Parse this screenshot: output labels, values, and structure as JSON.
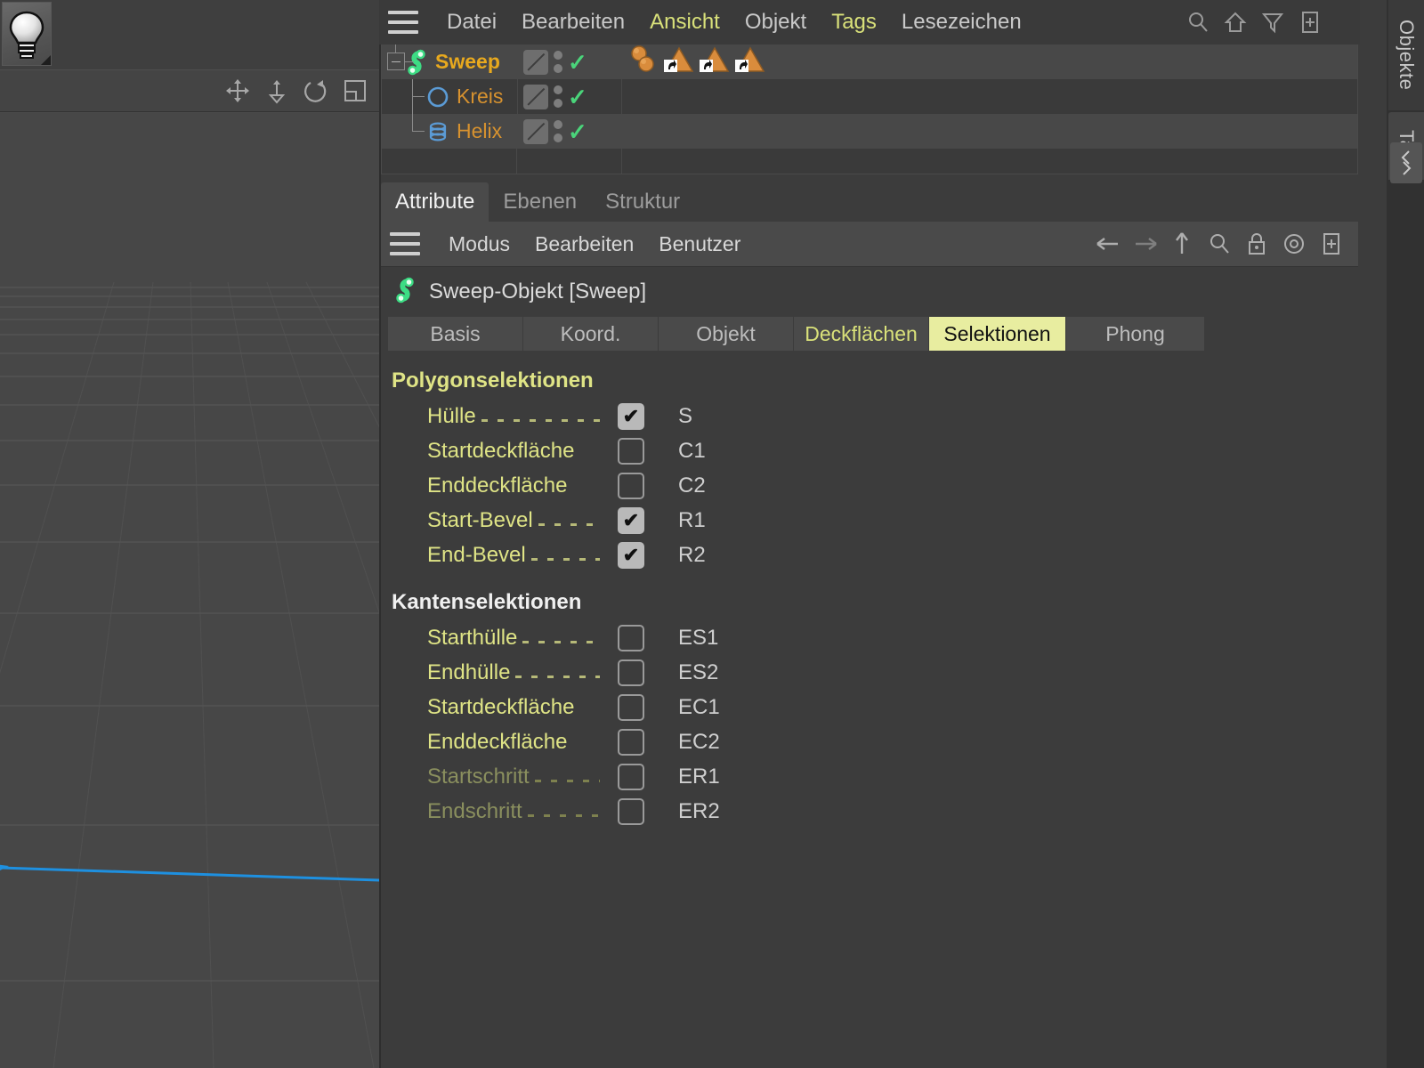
{
  "viewport": {
    "light_icon": "lightbulb-icon",
    "tools": [
      "move-icon",
      "scale-icon",
      "rotate-icon",
      "maximize-icon"
    ],
    "axis_color": "#1e90e0",
    "grid_color": "#5a5a5a",
    "background": "#474747"
  },
  "object_manager": {
    "menu": [
      {
        "label": "Datei",
        "highlight": false
      },
      {
        "label": "Bearbeiten",
        "highlight": false
      },
      {
        "label": "Ansicht",
        "highlight": true
      },
      {
        "label": "Objekt",
        "highlight": false
      },
      {
        "label": "Tags",
        "highlight": true
      },
      {
        "label": "Lesezeichen",
        "highlight": false
      }
    ],
    "tools": [
      "search-icon",
      "home-icon",
      "filter-icon",
      "add-layer-icon"
    ],
    "tree": [
      {
        "name": "Sweep",
        "icon": "sweep-object-icon",
        "level": 0,
        "expanded": true,
        "visible_tick": "✓",
        "tags": [
          "material-tag",
          "selection-tag",
          "selection-tag",
          "selection-tag"
        ]
      },
      {
        "name": "Kreis",
        "icon": "circle-spline-icon",
        "level": 1,
        "visible_tick": "✓",
        "tags": []
      },
      {
        "name": "Helix",
        "icon": "helix-spline-icon",
        "level": 1,
        "visible_tick": "✓",
        "tags": []
      }
    ]
  },
  "attribute_manager": {
    "panel_tabs": [
      {
        "label": "Attribute",
        "active": true
      },
      {
        "label": "Ebenen",
        "active": false
      },
      {
        "label": "Struktur",
        "active": false
      }
    ],
    "menu": [
      "Modus",
      "Bearbeiten",
      "Benutzer"
    ],
    "tools": [
      "back-arrow-icon",
      "forward-arrow-icon",
      "up-arrow-icon",
      "search-icon",
      "lock-icon",
      "target-icon",
      "add-icon"
    ],
    "object_title": "Sweep-Objekt [Sweep]",
    "object_icon": "sweep-object-icon",
    "subtabs": [
      {
        "label": "Basis",
        "active": false,
        "yellow": false
      },
      {
        "label": "Koord.",
        "active": false,
        "yellow": false
      },
      {
        "label": "Objekt",
        "active": false,
        "yellow": false
      },
      {
        "label": "Deckflächen",
        "active": false,
        "yellow": true
      },
      {
        "label": "Selektionen",
        "active": true,
        "yellow": false
      },
      {
        "label": "Phong",
        "active": false,
        "yellow": false
      }
    ],
    "sections": [
      {
        "title": "Polygonselektionen",
        "title_color": "yellow",
        "rows": [
          {
            "label": "Hülle",
            "checked": true,
            "code": "S",
            "disabled": false
          },
          {
            "label": "Startdeckfläche",
            "checked": false,
            "code": "C1",
            "disabled": false
          },
          {
            "label": "Enddeckfläche",
            "checked": false,
            "code": "C2",
            "disabled": false
          },
          {
            "label": "Start-Bevel",
            "checked": true,
            "code": "R1",
            "disabled": false
          },
          {
            "label": "End-Bevel",
            "checked": true,
            "code": "R2",
            "disabled": false
          }
        ]
      },
      {
        "title": "Kantenselektionen",
        "title_color": "white",
        "rows": [
          {
            "label": "Starthülle",
            "checked": false,
            "code": "ES1",
            "disabled": false
          },
          {
            "label": "Endhülle",
            "checked": false,
            "code": "ES2",
            "disabled": false
          },
          {
            "label": "Startdeckfläche",
            "checked": false,
            "code": "EC1",
            "disabled": false
          },
          {
            "label": "Enddeckfläche",
            "checked": false,
            "code": "EC2",
            "disabled": false
          },
          {
            "label": "Startschritt",
            "checked": false,
            "code": "ER1",
            "disabled": true
          },
          {
            "label": "Endschritt",
            "checked": false,
            "code": "ER2",
            "disabled": true
          }
        ]
      }
    ]
  },
  "side_tabs": [
    {
      "label": "Objekte",
      "active": true
    },
    {
      "label": "Tak",
      "active": false
    }
  ],
  "colors": {
    "accent_yellow": "#dfe486",
    "active_tab_bg": "#e8eda0",
    "parent_object": "#e8a91e",
    "child_object": "#d7922f",
    "check_green": "#4ad47a",
    "panel_bg": "#3c3c3c"
  }
}
